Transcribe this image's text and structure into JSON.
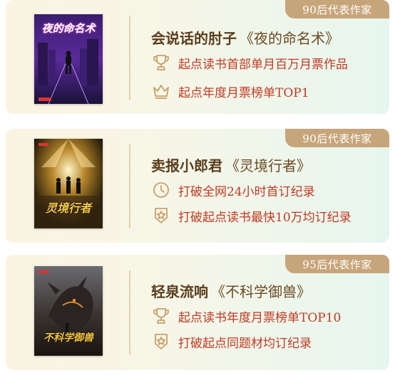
{
  "cards": [
    {
      "badge": "90后代表作家",
      "author": "会说话的肘子",
      "book": "《夜的命名术》",
      "cover_title": "夜的命名术",
      "features": [
        {
          "icon": "trophy-icon",
          "text": "起点读书首部单月百万月票作品"
        },
        {
          "icon": "crown-icon",
          "text": "起点年度月票榜单TOP1"
        }
      ]
    },
    {
      "badge": "90后代表作家",
      "author": "卖报小郎君",
      "book": "《灵境行者》",
      "cover_title": "灵境行者",
      "features": [
        {
          "icon": "clock-icon",
          "text": "打破全网24小时首订纪录"
        },
        {
          "icon": "star-badge-icon",
          "text": "打破起点读书最快10万均订纪录"
        }
      ]
    },
    {
      "badge": "95后代表作家",
      "author": "轻泉流响",
      "book": "《不科学御兽》",
      "cover_title": "不科学御兽",
      "features": [
        {
          "icon": "trophy-icon",
          "text": "起点读书年度月票榜单TOP10"
        },
        {
          "icon": "star-badge-icon",
          "text": "打破起点同题材均订纪录"
        }
      ]
    }
  ],
  "colors": {
    "badge_bg": "#c7a57a",
    "feature_text": "#c03a23",
    "author_text": "#5a3d1e",
    "icon": "#c9a06a"
  }
}
